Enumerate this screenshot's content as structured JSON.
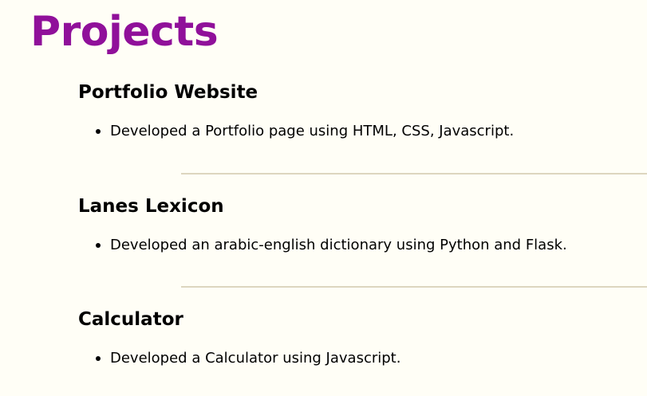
{
  "page": {
    "title": "Projects",
    "title_color": "#90109a",
    "divider_color": "#ddd6bf"
  },
  "projects": [
    {
      "title": "Portfolio Website",
      "items": [
        "Developed a Portfolio page using HTML, CSS, Javascript."
      ]
    },
    {
      "title": "Lanes Lexicon",
      "items": [
        "Developed an arabic-english dictionary using Python and Flask."
      ]
    },
    {
      "title": "Calculator",
      "items": [
        "Developed a Calculator using Javascript."
      ]
    }
  ]
}
